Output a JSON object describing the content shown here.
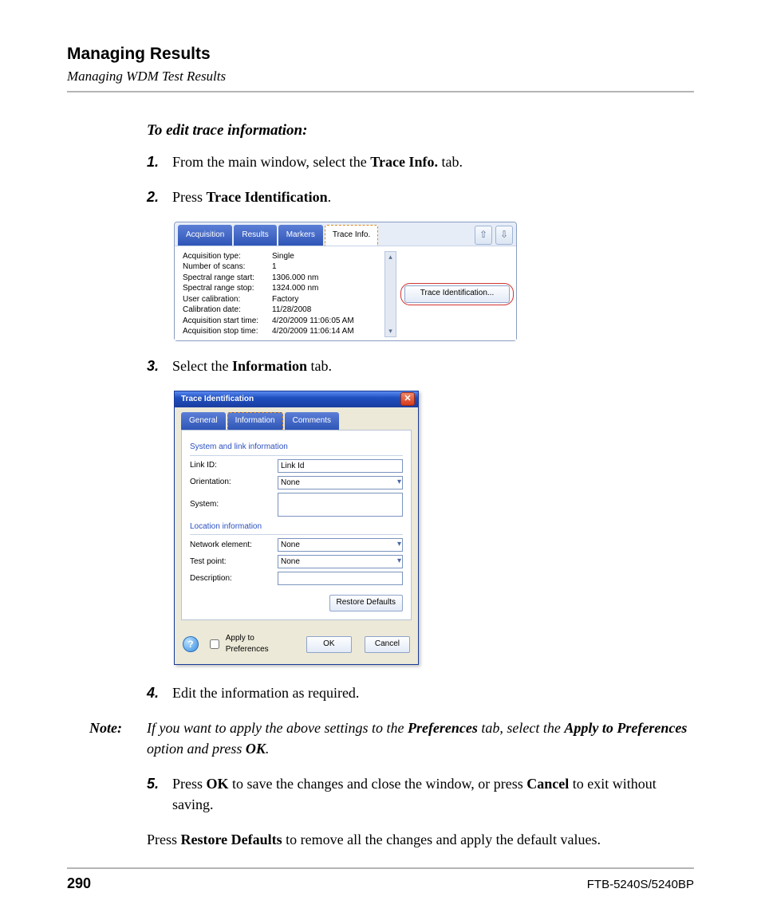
{
  "header": {
    "title": "Managing Results",
    "subtitle": "Managing WDM Test Results"
  },
  "section_heading": "To edit trace information:",
  "steps": {
    "s1": {
      "num": "1.",
      "pre": "From the main window, select the ",
      "bold": "Trace Info.",
      "post": " tab."
    },
    "s2": {
      "num": "2.",
      "pre": "Press ",
      "bold": "Trace Identification",
      "post": "."
    },
    "s3": {
      "num": "3.",
      "pre": "Select the ",
      "bold": "Information",
      "post": " tab."
    },
    "s4": {
      "num": "4.",
      "text": "Edit the information as required."
    },
    "s5": {
      "num": "5.",
      "pre": "Press ",
      "bold1": "OK",
      "mid": " to save the changes and close the window, or press ",
      "bold2": "Cancel",
      "post": " to exit without saving."
    }
  },
  "note": {
    "label": "Note:",
    "pre": "If you want to apply the above settings to the ",
    "b1": "Preferences",
    "mid": " tab, select the ",
    "b2": "Apply to Preferences",
    "mid2": " option and press ",
    "b3": "OK",
    "post": "."
  },
  "after_para": {
    "pre": "Press ",
    "bold": "Restore Defaults",
    "post": " to remove all the changes and apply the default values."
  },
  "ss1": {
    "tabs": {
      "acq": "Acquisition",
      "results": "Results",
      "markers": "Markers",
      "trace": "Trace Info."
    },
    "rows": [
      {
        "k": "Acquisition type:",
        "v": "Single"
      },
      {
        "k": "Number of scans:",
        "v": "1"
      },
      {
        "k": "Spectral range start:",
        "v": "1306.000 nm"
      },
      {
        "k": "Spectral range stop:",
        "v": "1324.000 nm"
      },
      {
        "k": "User calibration:",
        "v": "Factory"
      },
      {
        "k": "Calibration date:",
        "v": "11/28/2008"
      },
      {
        "k": "Acquisition start time:",
        "v": "4/20/2009 11:06:05 AM"
      },
      {
        "k": "Acquisition stop time:",
        "v": "4/20/2009 11:06:14 AM"
      }
    ],
    "side_button": "Trace Identification...",
    "nav_up": "⇧",
    "nav_down": "⇩",
    "scroll_up": "▴",
    "scroll_down": "▾"
  },
  "ss2": {
    "title": "Trace Identification",
    "close": "✕",
    "tabs": {
      "general": "General",
      "info": "Information",
      "comments": "Comments"
    },
    "group1": "System and link information",
    "group2": "Location information",
    "fields": {
      "linkid_label": "Link ID:",
      "linkid_value": "Link Id",
      "orientation_label": "Orientation:",
      "orientation_value": "None",
      "system_label": "System:",
      "system_value": "",
      "netelem_label": "Network element:",
      "netelem_value": "None",
      "testpoint_label": "Test point:",
      "testpoint_value": "None",
      "description_label": "Description:",
      "description_value": ""
    },
    "restore": "Restore Defaults",
    "apply_pref": "Apply to Preferences",
    "ok": "OK",
    "cancel": "Cancel",
    "help": "?"
  },
  "footer": {
    "page": "290",
    "model": "FTB-5240S/5240BP"
  }
}
